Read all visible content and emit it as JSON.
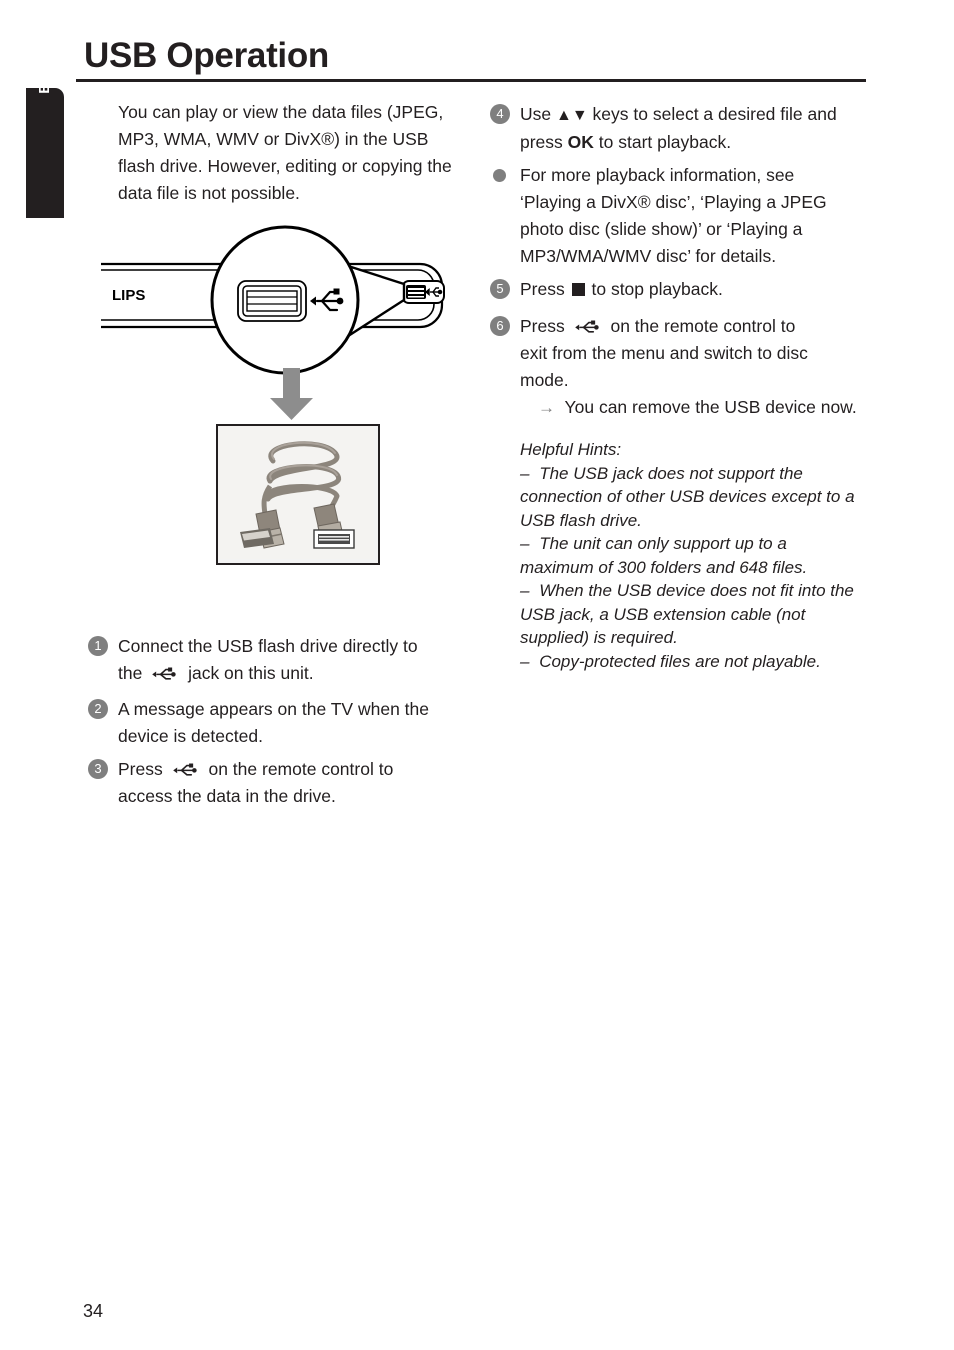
{
  "page": {
    "title": "USB Operation",
    "language_tab": "English",
    "page_number": "34"
  },
  "intro": {
    "line1": "You can play or view the data files (JPEG,",
    "line2": "MP3, WMA, WMV or DivX®) in the",
    "line3": "USB flash drive. However, editing or",
    "line4": "copying the data file is not possible."
  },
  "diagram": {
    "brand_label": "LIPS",
    "magnifier_name": "magnifier-callout",
    "usb_port_label": "usb-port",
    "photo_caption": "usb-extension-cable-photo"
  },
  "steps_left": [
    {
      "marker": "1",
      "type": "number",
      "line1": "Connect the USB flash drive directly to",
      "line2_before": "the",
      "icon": "usb-icon",
      "line2_after": "jack on this unit."
    },
    {
      "marker": "2",
      "type": "number",
      "line1": "A message appears on the TV when the",
      "line2": "device is detected."
    },
    {
      "marker": "3",
      "type": "number",
      "line1_before": "Press",
      "icon": "usb-icon",
      "line1_after": "on the remote control to",
      "line2": "access the data in the drive."
    }
  ],
  "steps_right": [
    {
      "marker": "4",
      "type": "number",
      "line1_before": "Use",
      "keys": "▲▼",
      "line1_after": "keys to select a desired file and",
      "line2_before": "press",
      "bold": "OK",
      "line2_after": "to start playback."
    },
    {
      "marker": "•",
      "type": "dot",
      "line1": "For more playback information, see",
      "line2": "‘Playing a DivX® disc’, ‘Playing a JPEG",
      "line3": "photo disc (slide show)’ or ‘Playing a",
      "line4": "MP3/WMA/WMV disc’ for details."
    },
    {
      "marker": "5",
      "type": "number",
      "line1_before": "Press",
      "glyph": "stop-square",
      "line1_after": "to stop playback."
    },
    {
      "marker": "6",
      "type": "number",
      "line1_before": "Press",
      "icon": "usb-icon",
      "line1_after": "on the remote control to",
      "line2": "exit from the menu and switch to disc",
      "line3": "mode.",
      "result_arrow": "→",
      "result": "You can remove the USB device now."
    }
  ],
  "hints": {
    "heading": "Helpful Hints:",
    "items": [
      {
        "dash": "–",
        "lines": [
          "The USB jack does not support the",
          "connection of other USB devices except to a",
          "USB flash drive."
        ]
      },
      {
        "dash": "–",
        "lines": [
          "The unit can only support up to a",
          "maximum of 300 folders and 648 files."
        ]
      },
      {
        "dash": "–",
        "lines": [
          "When the USB device does not fit into the",
          "USB jack, a USB extension cable (not",
          "supplied) is required."
        ]
      },
      {
        "dash": "–",
        "lines": [
          "Copy-protected files are not playable."
        ]
      }
    ]
  },
  "colors": {
    "text": "#231f20",
    "marker_gray": "#7f7f7f",
    "tab_black": "#231f20"
  }
}
